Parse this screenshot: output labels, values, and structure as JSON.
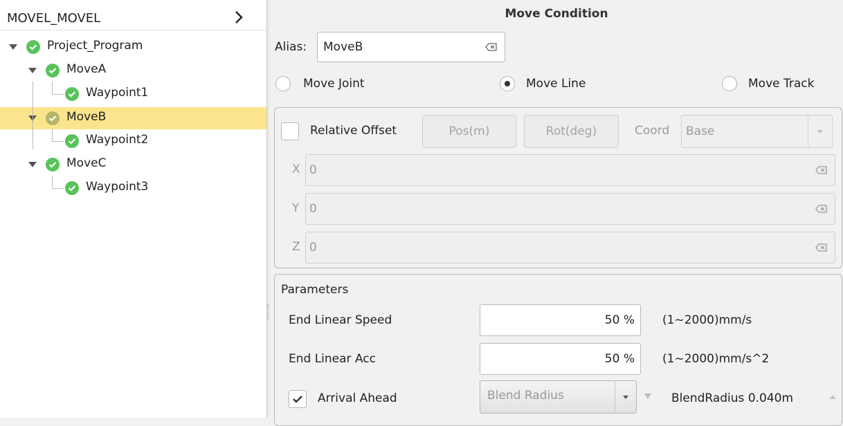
{
  "tree": {
    "title": "MOVEL_MOVEL",
    "items": [
      {
        "label": "Project_Program"
      },
      {
        "label": "MoveA"
      },
      {
        "label": "Waypoint1"
      },
      {
        "label": "MoveB"
      },
      {
        "label": "Waypoint2"
      },
      {
        "label": "MoveC"
      },
      {
        "label": "Waypoint3"
      }
    ],
    "selected": "MoveB"
  },
  "move_condition": {
    "title": "Move Condition",
    "alias_label": "Alias:",
    "alias_value": "MoveB",
    "options": [
      {
        "label": "Move Joint",
        "selected": false
      },
      {
        "label": "Move Line",
        "selected": true
      },
      {
        "label": "Move Track",
        "selected": false
      }
    ]
  },
  "offset": {
    "checkbox_label": "Relative Offset",
    "pos_button": "Pos(m)",
    "rot_button": "Rot(deg)",
    "coord_label": "Coord",
    "coord_value": "Base",
    "x_label": "X",
    "x_value": "0",
    "y_label": "Y",
    "y_value": "0",
    "z_label": "Z",
    "z_value": "0"
  },
  "parameters": {
    "title": "Parameters",
    "speed_label": "End Linear Speed",
    "speed_value": "50 %",
    "speed_range": "(1~2000)mm/s",
    "acc_label": "End Linear Acc",
    "acc_value": "50 %",
    "acc_range": "(1~2000)mm/s^2",
    "arrival_label": "Arrival Ahead",
    "arrival_checked": true,
    "blend_combo": "Blend Radius",
    "blend_readout": "BlendRadius 0.040m"
  },
  "colors": {
    "selection": "#fbe58c",
    "check_green": "#58c35a",
    "check_olive": "#b7b56a"
  }
}
